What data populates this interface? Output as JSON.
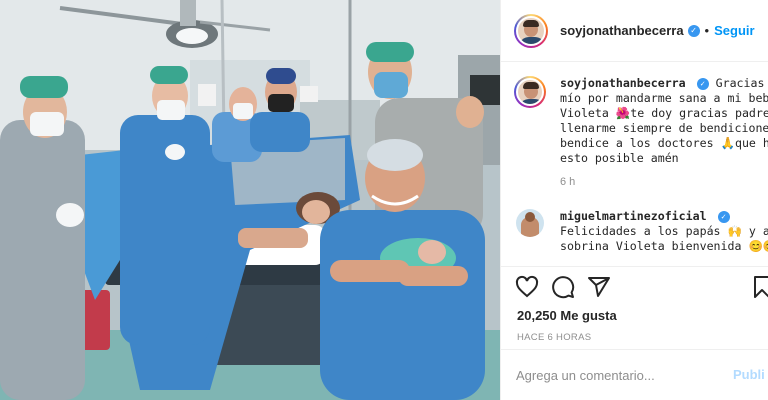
{
  "post": {
    "username": "soyjonathanbecerra",
    "verified_icon": "verified-badge-icon",
    "follow_label": "Seguir",
    "separator": "•"
  },
  "caption": {
    "username": "soyjonathanbecerra",
    "lines": [
      "Gracias Dios",
      "mío por mandarme sana a mi bebé",
      "Violeta 🌺te doy gracias padre mío por",
      "llenarme siempre de bendiciones,",
      "bendice a los doctores 🙏que hicieron",
      "esto posible amén"
    ],
    "time": "6 h"
  },
  "comment": {
    "username": "miguelmartinezoficial",
    "lines": [
      "Felicidades a los papás 🙌 y a mi",
      "sobrina Violeta bienvenida 😊😊"
    ]
  },
  "actions": {
    "like_icon": "heart-icon",
    "comment_icon": "comment-icon",
    "share_icon": "share-icon",
    "save_icon": "bookmark-icon"
  },
  "likes": "20,250 Me gusta",
  "posted_ago": "HACE 6 HORAS",
  "add_comment": {
    "placeholder": "Agrega un comentario...",
    "publish_label": "Publi"
  },
  "colors": {
    "link_blue": "#0095f6",
    "verified_blue": "#3897f0",
    "publish_disabled": "#b3dbff",
    "scrub_blue": "#3f86c8"
  }
}
